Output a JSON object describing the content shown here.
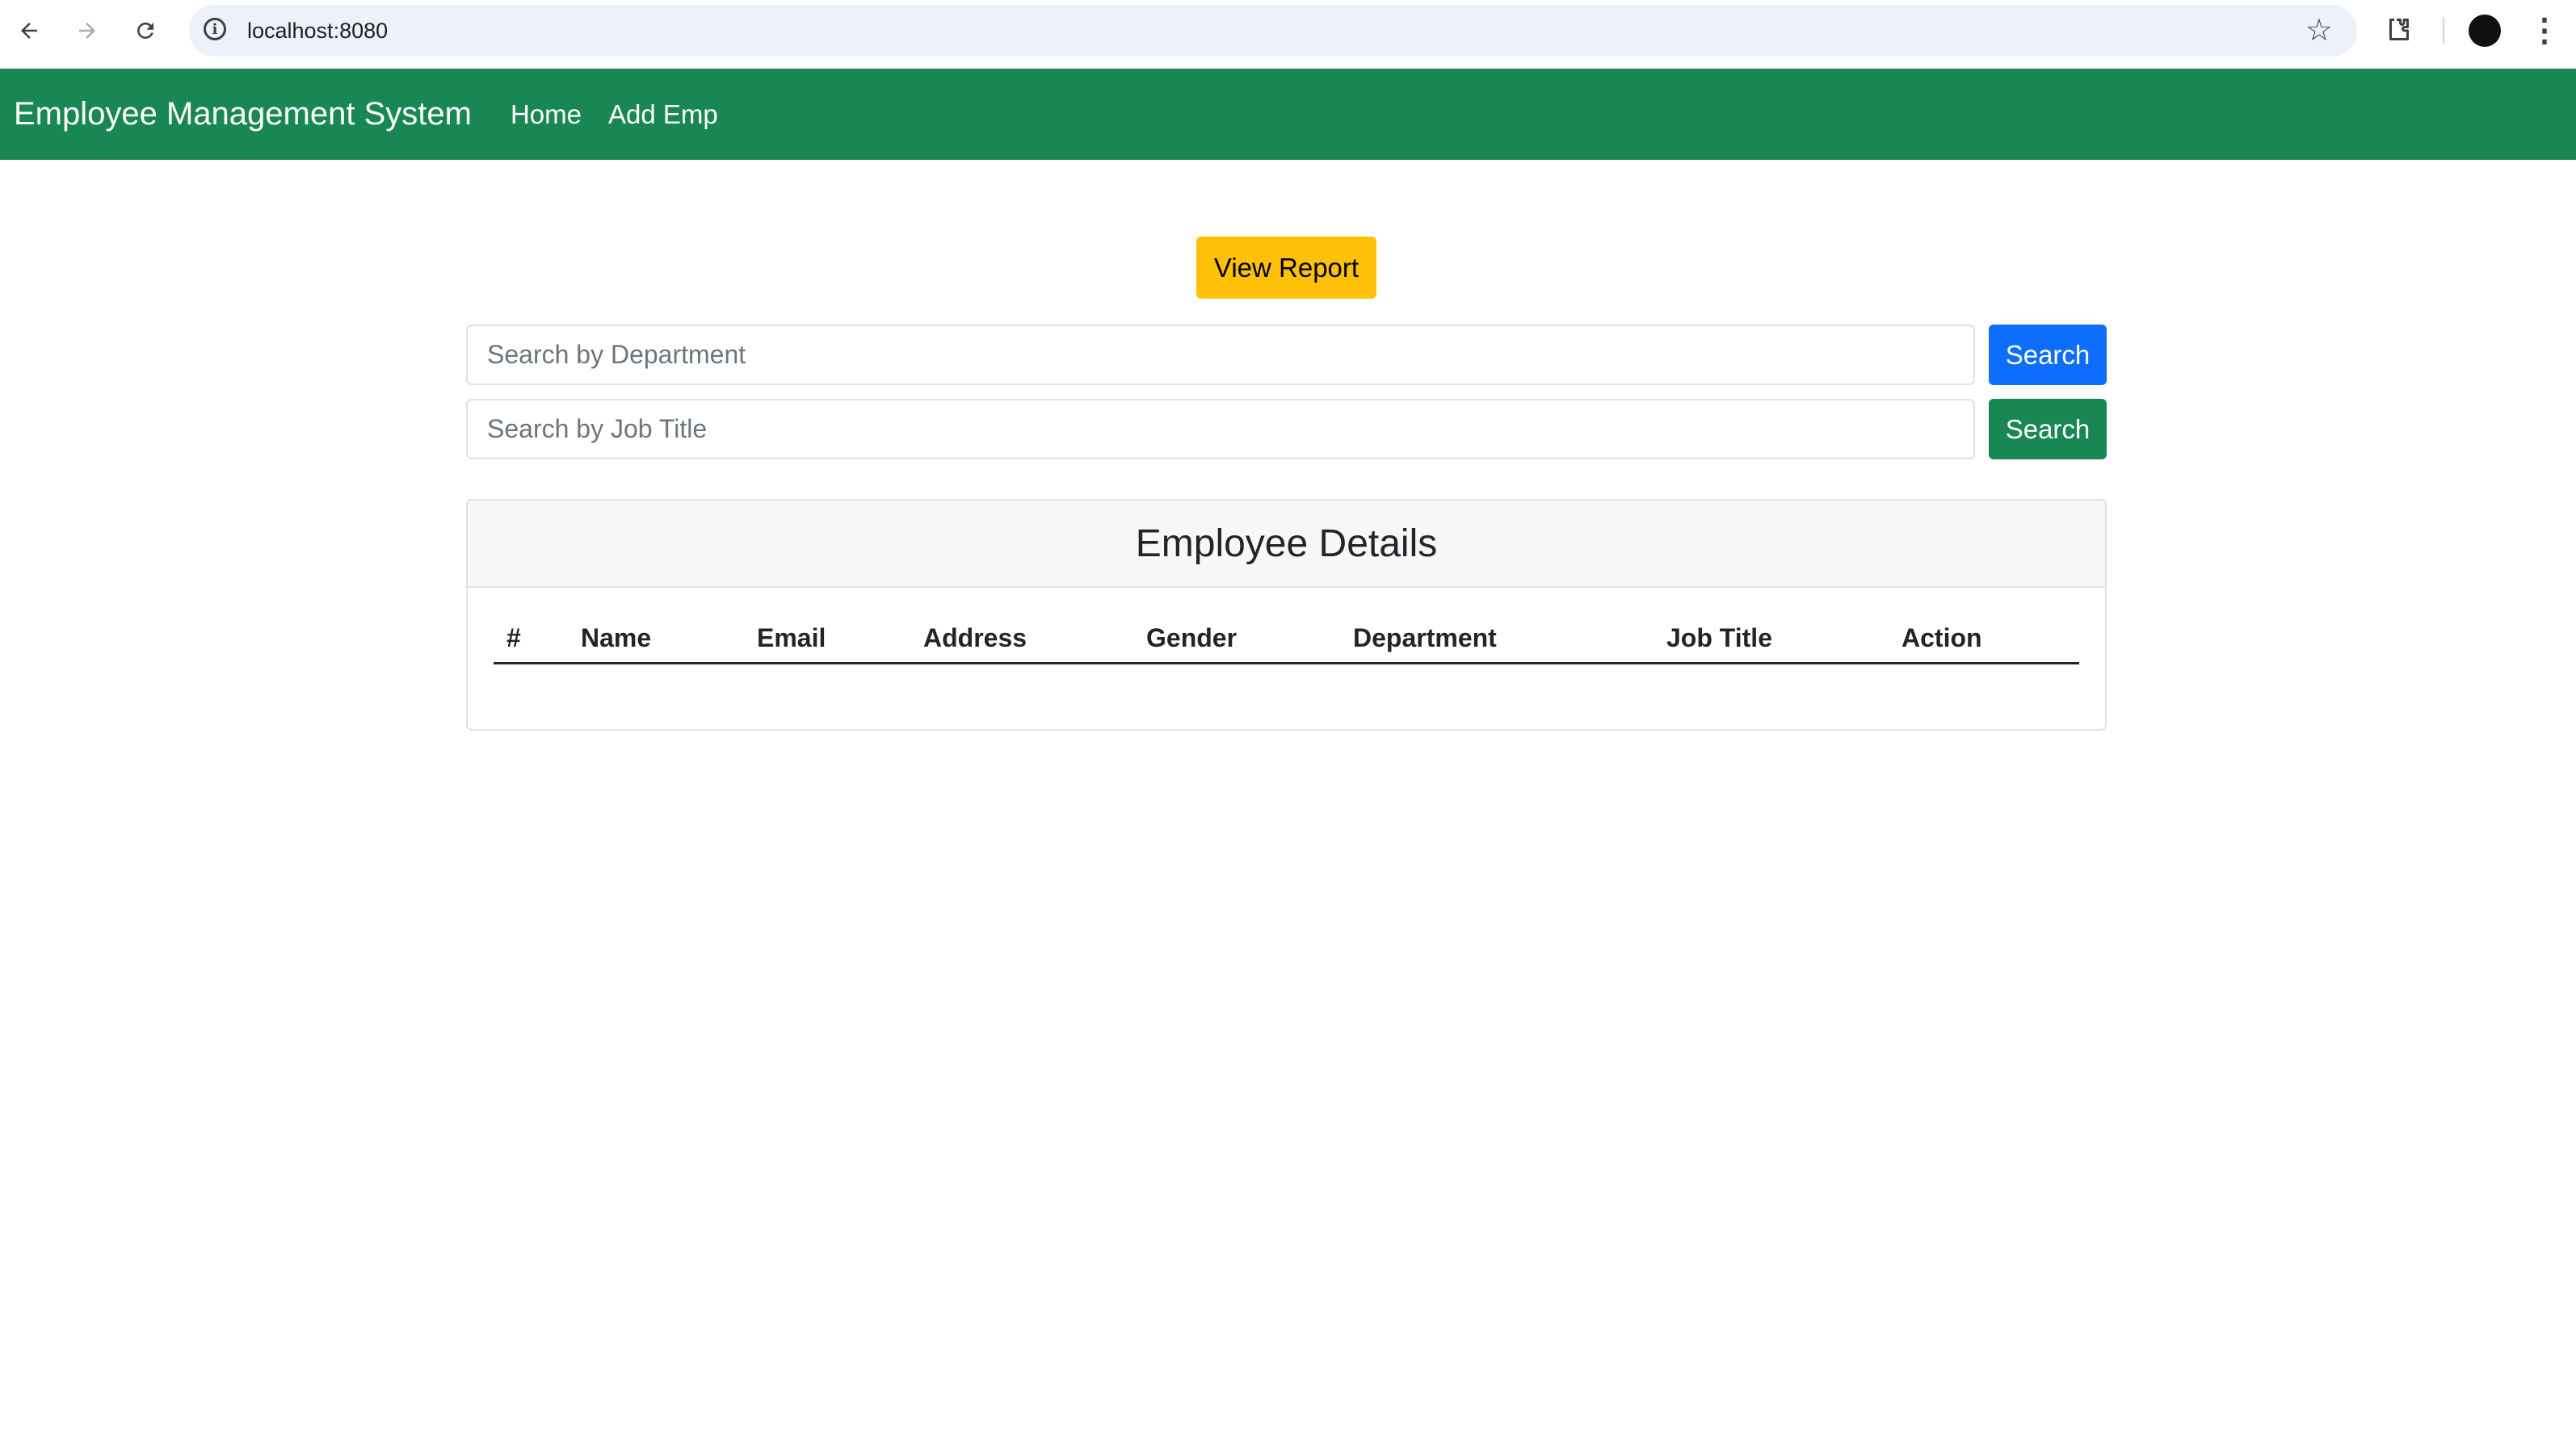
{
  "browser": {
    "url": "localhost:8080"
  },
  "navbar": {
    "brand": "Employee Management System",
    "links": [
      "Home",
      "Add Emp"
    ]
  },
  "actions": {
    "view_report_label": "View Report"
  },
  "search": {
    "department_placeholder": "Search by Department",
    "job_title_placeholder": "Search by Job Title",
    "button_label": "Search"
  },
  "employee_card": {
    "title": "Employee Details",
    "columns": [
      "#",
      "Name",
      "Email",
      "Address",
      "Gender",
      "Department",
      "Job Title",
      "Action"
    ],
    "rows": []
  },
  "colors": {
    "navbar": "#198754",
    "report_button": "#ffc107",
    "search_primary": "#0d6efd",
    "search_success": "#198754"
  },
  "icons": {
    "back": "arrow-left",
    "forward": "arrow-right",
    "reload": "reload",
    "site_info": "info-circle",
    "bookmark": "star-outline",
    "extensions": "puzzle-piece",
    "profile": "avatar",
    "menu": "three-dots-vertical"
  }
}
